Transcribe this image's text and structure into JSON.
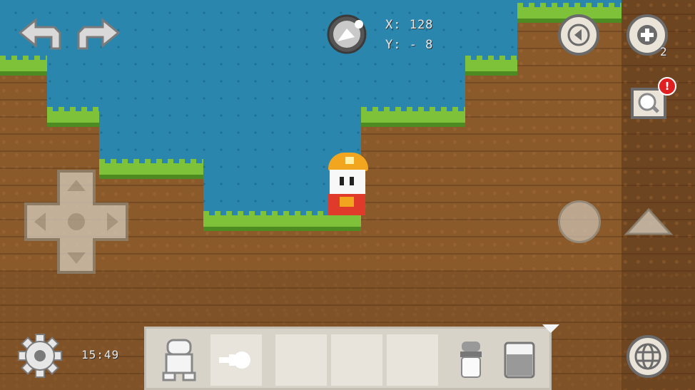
{
  "hud": {
    "coord_x": "X: 128",
    "coord_y": "Y: - 8",
    "clock": "15:49",
    "zoom_badge": "2",
    "alert_badge": "!"
  },
  "icons": {
    "undo": "undo-arrow-icon",
    "redo": "redo-arrow-icon",
    "compass": "compass-icon",
    "rewind": "rewind-icon",
    "zoom_in": "zoom-in-icon",
    "search": "magnifier-icon",
    "dpad": "dpad-icon",
    "action": "action-circle-icon",
    "jump": "jump-triangle-icon",
    "settings": "gear-icon",
    "globe": "globe-icon"
  },
  "toolbar": {
    "slots": [
      "character",
      "flashlight",
      "empty",
      "empty",
      "empty"
    ],
    "extra_items": [
      "canister",
      "block"
    ]
  },
  "colors": {
    "sky": "#2a86ad",
    "grass": "#7ec23a",
    "dirt": "#8a5a2b",
    "toolbar": "#d8d3c8"
  }
}
